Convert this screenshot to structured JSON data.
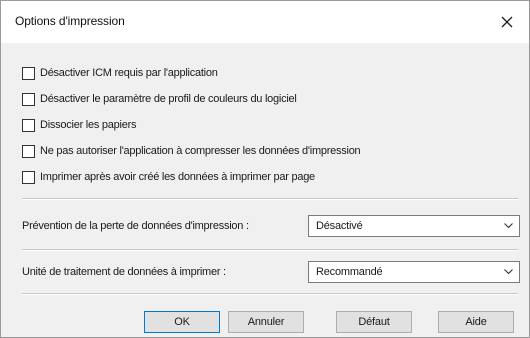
{
  "dialog": {
    "title": "Options d'impression",
    "close_label": "×"
  },
  "options": [
    {
      "label": "Désactiver ICM requis par l'application",
      "checked": false
    },
    {
      "label": "Désactiver le paramètre de profil de couleurs du logiciel",
      "checked": false
    },
    {
      "label": "Dissocier les papiers",
      "checked": false
    },
    {
      "label": "Ne pas autoriser l'application à compresser les données d'impression",
      "checked": false
    },
    {
      "label": "Imprimer après avoir créé les données à imprimer par page",
      "checked": false
    }
  ],
  "prevention": {
    "label": "Prévention de la perte de données d'impression :",
    "value": "Désactivé"
  },
  "unit": {
    "label": "Unité de traitement de données à imprimer :",
    "value": "Recommandé"
  },
  "buttons": {
    "ok": "OK",
    "cancel": "Annuler",
    "default": "Défaut",
    "help": "Aide"
  },
  "icons": {
    "close": "close-icon",
    "dropdown": "chevron-down-icon"
  },
  "colors": {
    "default_button_border": "#0078d7",
    "dialog_background": "#f0f0f0"
  }
}
